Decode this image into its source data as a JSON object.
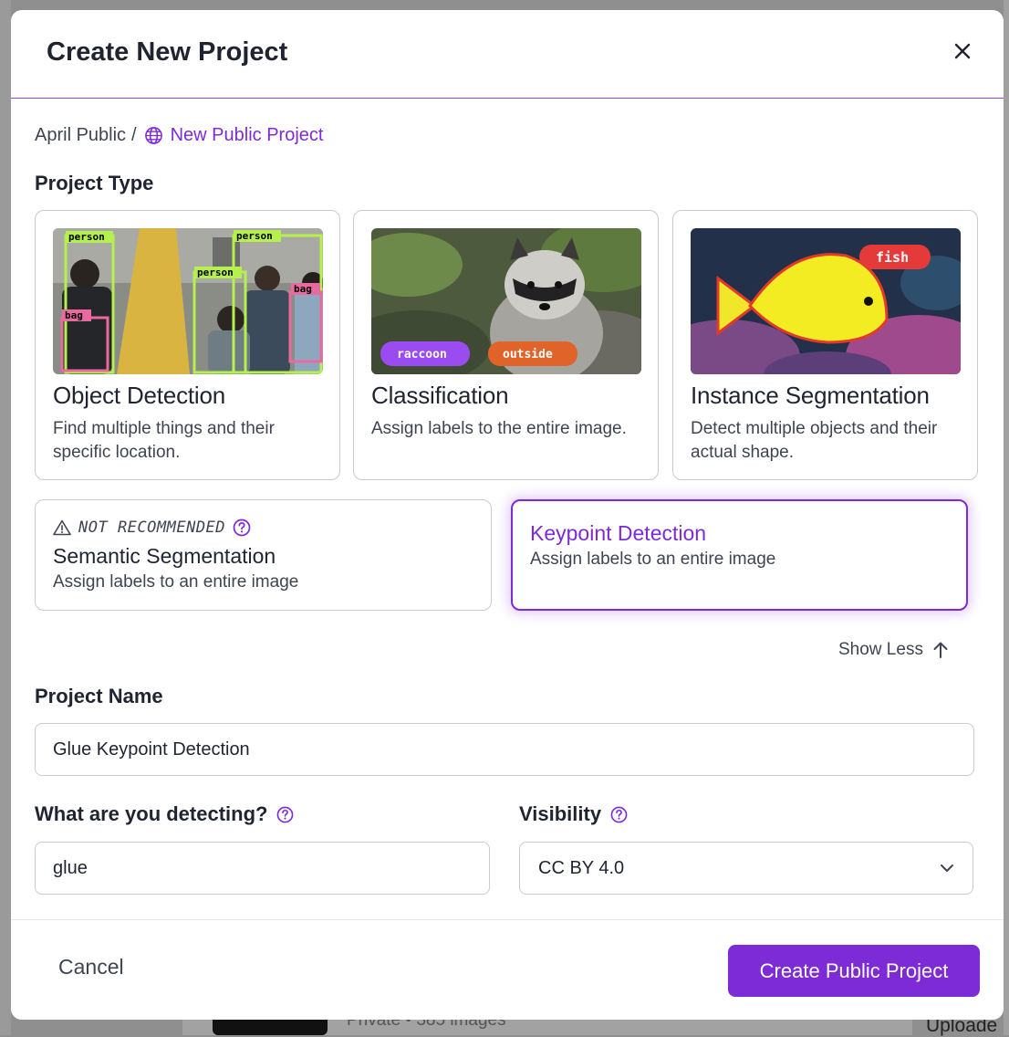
{
  "modal": {
    "title": "Create New Project",
    "close_icon": "close-icon"
  },
  "breadcrumb": {
    "workspace": "April Public",
    "separator": "/",
    "project": "New Public Project",
    "project_icon": "globe-icon"
  },
  "project_type": {
    "label": "Project Type",
    "cards": [
      {
        "title": "Object Detection",
        "description": "Find multiple things and their specific location.",
        "thumb_tags": [
          "person",
          "person",
          "person",
          "bag",
          "bag"
        ]
      },
      {
        "title": "Classification",
        "description": "Assign labels to the entire image.",
        "thumb_tags": [
          "raccoon",
          "outside"
        ]
      },
      {
        "title": "Instance Segmentation",
        "description": "Detect multiple objects and their actual shape.",
        "thumb_tags": [
          "fish"
        ]
      }
    ],
    "semantic": {
      "warning": "NOT RECOMMENDED",
      "title": "Semantic Segmentation",
      "description": "Assign labels to an entire image"
    },
    "keypoint": {
      "title": "Keypoint Detection",
      "description": "Assign labels to an entire image",
      "selected": true
    },
    "show_less": "Show Less"
  },
  "project_name": {
    "label": "Project Name",
    "value": "Glue Keypoint Detection"
  },
  "detecting": {
    "label": "What are you detecting?",
    "value": "glue"
  },
  "visibility": {
    "label": "Visibility",
    "selected": "CC BY 4.0"
  },
  "footer": {
    "cancel": "Cancel",
    "create": "Create Public Project"
  },
  "background": {
    "meta": "Private • 385 images",
    "upload": "Uploade"
  },
  "colors": {
    "accent": "#7d2bd6",
    "border": "#c8cbd2",
    "text": "#1f2430"
  }
}
